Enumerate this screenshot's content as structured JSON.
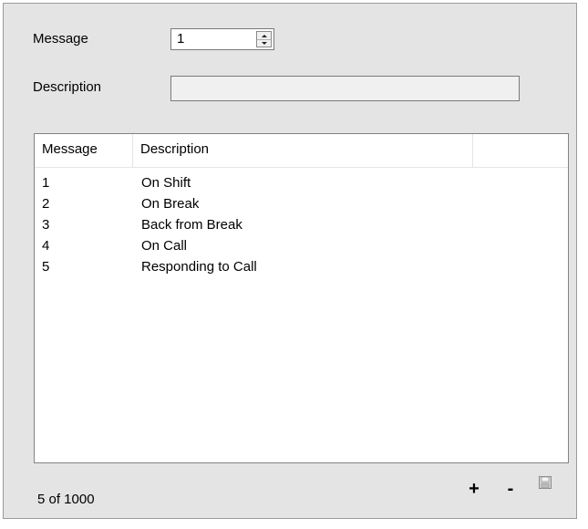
{
  "form": {
    "message_label": "Message",
    "message_value": "1",
    "description_label": "Description",
    "description_value": ""
  },
  "list": {
    "columns": [
      "Message",
      "Description",
      ""
    ],
    "rows": [
      {
        "message": "1",
        "description": "On Shift"
      },
      {
        "message": "2",
        "description": "On Break"
      },
      {
        "message": "3",
        "description": "Back from Break"
      },
      {
        "message": "4",
        "description": "On Call"
      },
      {
        "message": "5",
        "description": "Responding to Call"
      }
    ]
  },
  "footer": {
    "count_text": "5 of 1000",
    "add_label": "+",
    "remove_label": "-"
  },
  "icons": {
    "spin_up": "chevron-up-icon",
    "spin_down": "chevron-down-icon",
    "save": "save-icon"
  }
}
